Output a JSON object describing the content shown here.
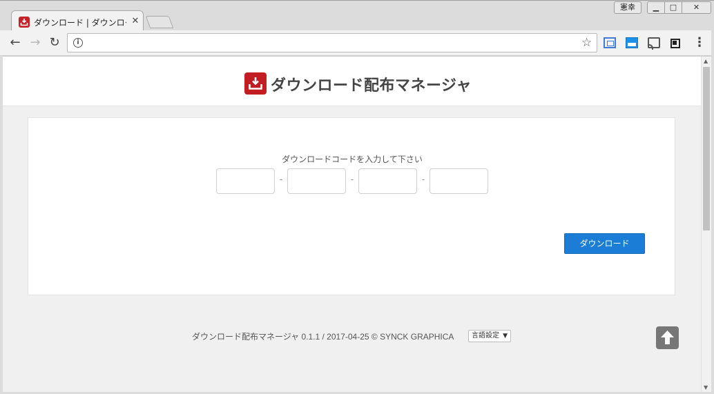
{
  "window": {
    "user_badge": "憲幸",
    "minimize": "▁",
    "maximize": "□",
    "close": "✕"
  },
  "tab": {
    "title": "ダウンロード | ダウンロード配",
    "close": "✕"
  },
  "toolbar": {
    "back": "←",
    "forward": "→",
    "reload": "↻",
    "info": "i",
    "url": "",
    "star": "☆",
    "menu": "⋮"
  },
  "site": {
    "title": "ダウンロード配布マネージャ"
  },
  "form": {
    "label": "ダウンロードコードを入力して下さい",
    "code_values": [
      "",
      "",
      "",
      ""
    ],
    "separator": "-",
    "button_label": "ダウンロード"
  },
  "footer": {
    "text": "ダウンロード配布マネージャ 0.1.1 / 2017-04-25 © SYNCK GRAPHICA",
    "language_select": "言語設定",
    "language_arrow": "▼"
  },
  "scrollbar": {
    "up": "▲",
    "down": "▼"
  },
  "colors": {
    "brand_red": "#c11d23",
    "button_blue": "#1b7dd6"
  }
}
